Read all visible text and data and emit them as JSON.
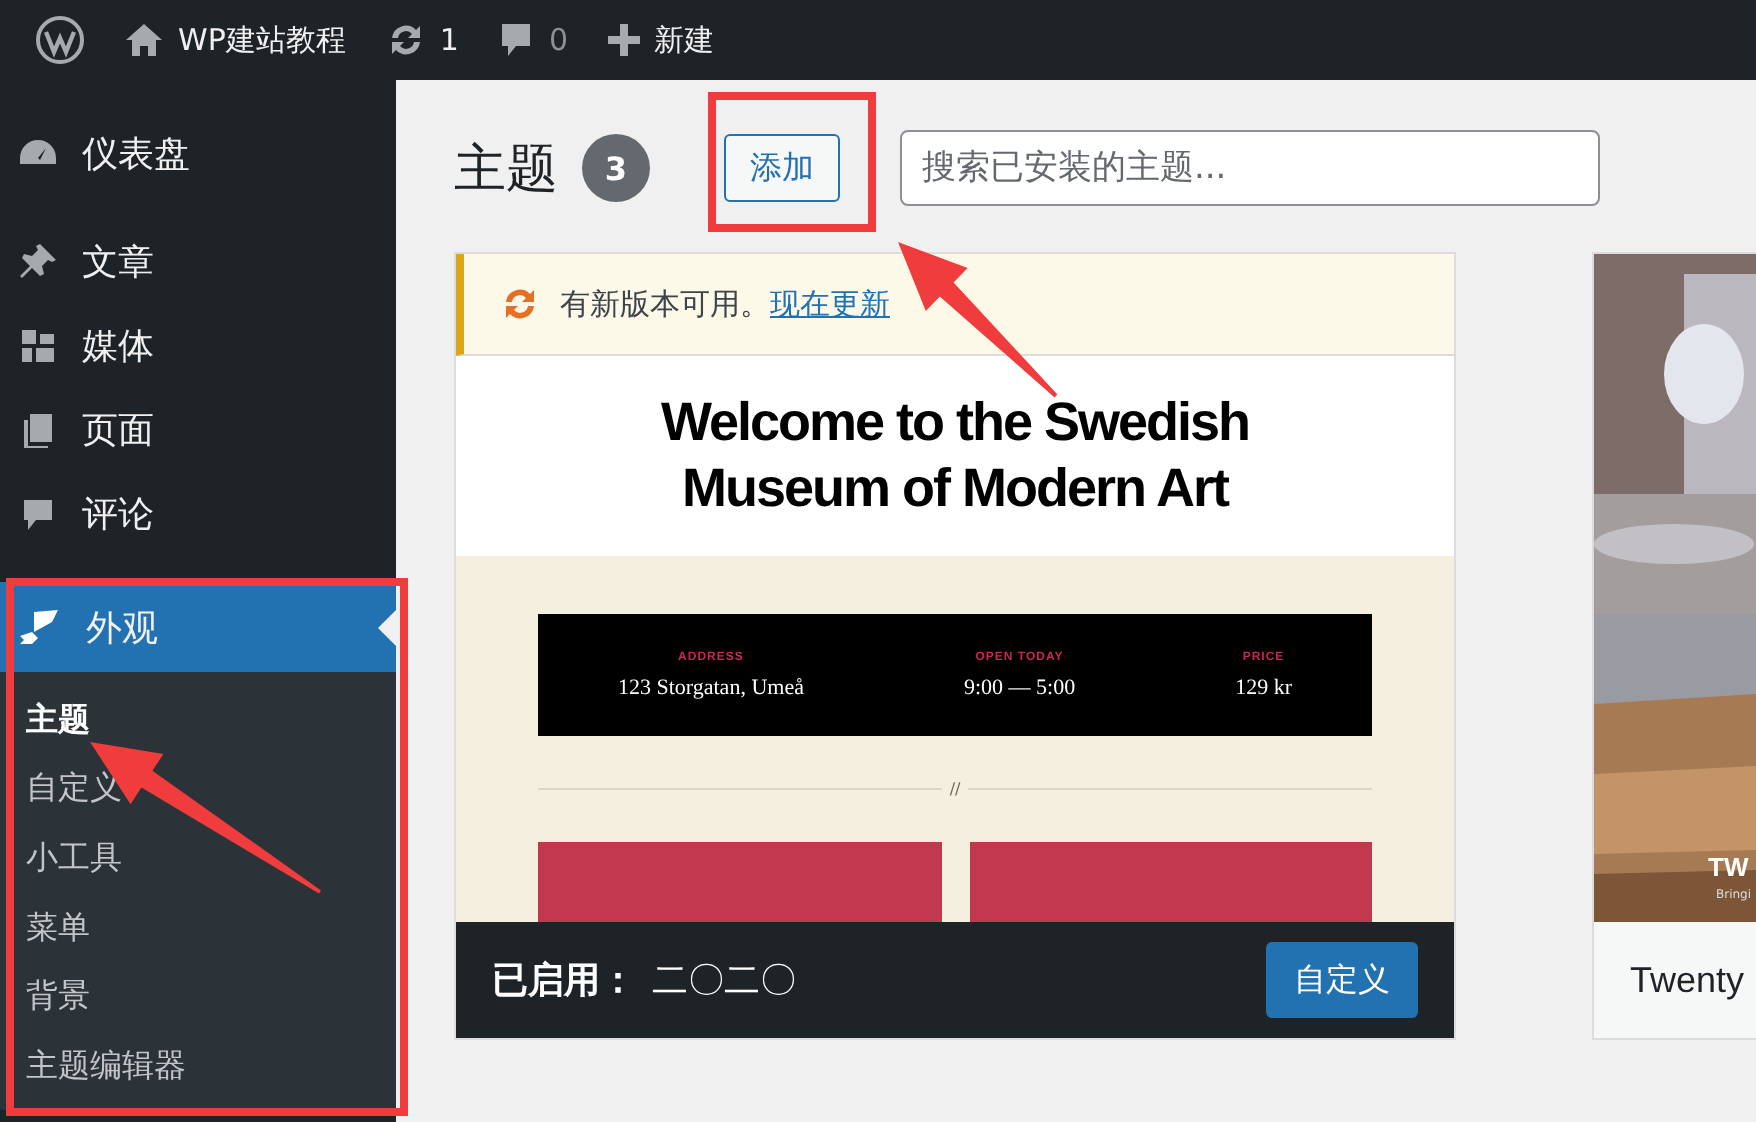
{
  "admin_bar": {
    "items": [
      {
        "kind": "logo"
      },
      {
        "kind": "site",
        "label": "WP建站教程"
      },
      {
        "kind": "updates",
        "label": "1"
      },
      {
        "kind": "comments",
        "label": "0"
      },
      {
        "kind": "new",
        "label": "新建"
      }
    ]
  },
  "sidebar": {
    "items": [
      {
        "kind": "dashboard",
        "label": "仪表盘",
        "selected": false
      },
      {
        "kind": "posts",
        "label": "文章",
        "selected": false
      },
      {
        "kind": "media",
        "label": "媒体",
        "selected": false
      },
      {
        "kind": "pages",
        "label": "页面",
        "selected": false
      },
      {
        "kind": "comments",
        "label": "评论",
        "selected": false
      },
      {
        "kind": "appearance",
        "label": "外观",
        "selected": true,
        "children": [
          {
            "label": "主题",
            "selected": true
          },
          {
            "label": "自定义",
            "selected": false
          },
          {
            "label": "小工具",
            "selected": false
          },
          {
            "label": "菜单",
            "selected": false
          },
          {
            "label": "背景",
            "selected": false
          },
          {
            "label": "主题编辑器",
            "selected": false
          }
        ]
      }
    ]
  },
  "page": {
    "title": "主题",
    "count": "3",
    "add_button": "添加",
    "search": {
      "placeholder": "搜索已安装的主题..."
    }
  },
  "themes": [
    {
      "kind": "active",
      "notice": {
        "text": "有新版本可用。",
        "link": "现在更新"
      },
      "preview": {
        "heading": "Welcome to the Swedish Museum of Modern Art",
        "info": [
          {
            "label": "ADDRESS",
            "value": "123 Storgatan, Umeå"
          },
          {
            "label": "OPEN TODAY",
            "value": "9:00 — 5:00"
          },
          {
            "label": "PRICE",
            "value": "129 kr"
          }
        ],
        "divider": "//"
      },
      "status": "已启用：",
      "name": "二〇二〇",
      "action": "自定义"
    },
    {
      "kind": "inactive",
      "preview": {
        "overlay_title": "TW",
        "overlay_subtitle": "Bringi"
      },
      "name": "Twenty"
    }
  ],
  "annotations": [
    {
      "kind": "frame"
    },
    {
      "kind": "arrow"
    },
    {
      "kind": "frame"
    },
    {
      "kind": "arrow"
    }
  ]
}
